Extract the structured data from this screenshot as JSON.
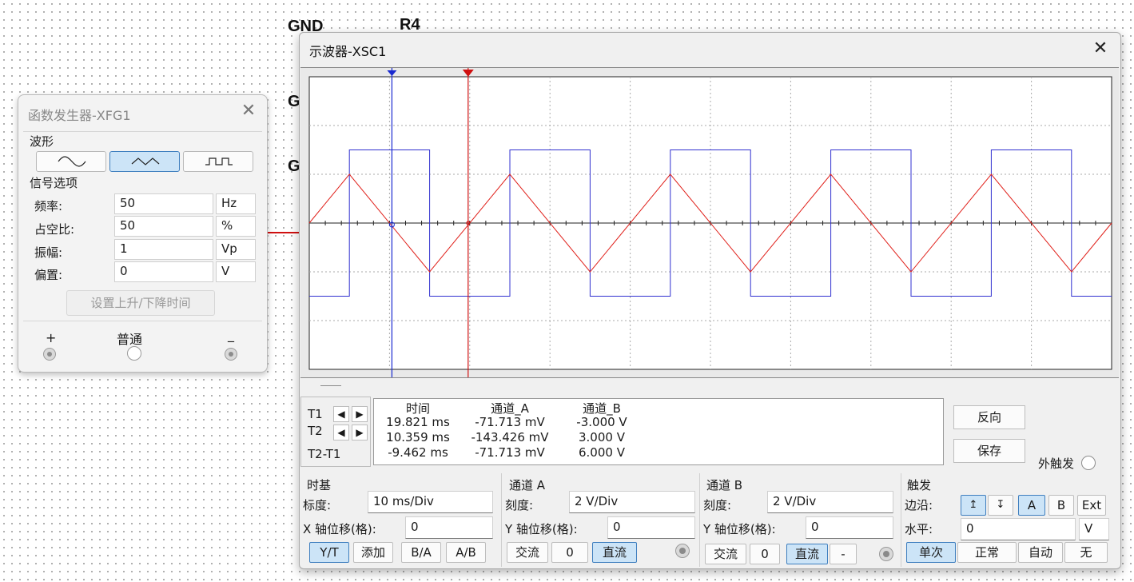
{
  "schematic": {
    "labels": [
      "GND",
      "R4",
      "G",
      "G"
    ]
  },
  "function_generator": {
    "title": "函数发生器-XFG1",
    "waveform_label": "波形",
    "waveforms": [
      {
        "name": "sine",
        "active": false
      },
      {
        "name": "triangle",
        "active": true
      },
      {
        "name": "square",
        "active": false
      }
    ],
    "signal_options_label": "信号选项",
    "rows": [
      {
        "label": "频率:",
        "value": "50",
        "unit": "Hz"
      },
      {
        "label": "占空比:",
        "value": "50",
        "unit": "%"
      },
      {
        "label": "振幅:",
        "value": "1",
        "unit": "Vp"
      },
      {
        "label": "偏置:",
        "value": "0",
        "unit": "V"
      }
    ],
    "rise_fall_button": "设置上升/下降时间",
    "terminals": {
      "plus": "+",
      "common": "普通",
      "minus": "_"
    }
  },
  "oscilloscope": {
    "title": "示波器-XSC1",
    "colors": {
      "channel_a": "#e0201a",
      "channel_b": "#3030d0",
      "cursor_t1": "#1a2ad0",
      "cursor_t2": "#d01010",
      "accent": "#cce4f7"
    },
    "cursor_labels": {
      "t1": "T1",
      "t2": "T2",
      "t2_t1": "T2-T1"
    },
    "readout": {
      "headers": [
        "时间",
        "通道_A",
        "通道_B"
      ],
      "rows": [
        [
          "19.821 ms",
          "-71.713 mV",
          "-3.000 V"
        ],
        [
          "10.359 ms",
          "-143.426 mV",
          "3.000 V"
        ],
        [
          "-9.462 ms",
          "-71.713 mV",
          "6.000 V"
        ]
      ]
    },
    "buttons": {
      "reverse": "反向",
      "save": "保存",
      "ext_trigger": "外触发"
    },
    "timebase": {
      "title": "时基",
      "scale_label": "标度:",
      "scale_value": "10 ms/Div",
      "xpos_label": "X 轴位移(格):",
      "xpos_value": "0",
      "modes": [
        {
          "label": "Y/T",
          "active": true
        },
        {
          "label": "添加",
          "active": false
        },
        {
          "label": "B/A",
          "active": false
        },
        {
          "label": "A/B",
          "active": false
        }
      ]
    },
    "channel_a": {
      "title": "通道 A",
      "scale_label": "刻度:",
      "scale_value": "2  V/Div",
      "ypos_label": "Y 轴位移(格):",
      "ypos_value": "0",
      "coupling": [
        {
          "label": "交流",
          "active": false
        },
        {
          "label": "0",
          "active": false
        },
        {
          "label": "直流",
          "active": true
        }
      ]
    },
    "channel_b": {
      "title": "通道 B",
      "scale_label": "刻度:",
      "scale_value": "2  V/Div",
      "ypos_label": "Y 轴位移(格):",
      "ypos_value": "0",
      "coupling": [
        {
          "label": "交流",
          "active": false
        },
        {
          "label": "0",
          "active": false
        },
        {
          "label": "直流",
          "active": true
        },
        {
          "label": "-",
          "active": false
        }
      ]
    },
    "trigger": {
      "title": "触发",
      "edge_label": "边沿:",
      "sources": [
        {
          "label": "A",
          "active": true
        },
        {
          "label": "B",
          "active": false
        },
        {
          "label": "Ext",
          "active": false
        }
      ],
      "level_label": "水平:",
      "level_value": "0",
      "level_unit": "V",
      "modes": [
        {
          "label": "单次",
          "active": true
        },
        {
          "label": "正常",
          "active": false
        },
        {
          "label": "自动",
          "active": false
        },
        {
          "label": "无",
          "active": false
        }
      ]
    }
  }
}
